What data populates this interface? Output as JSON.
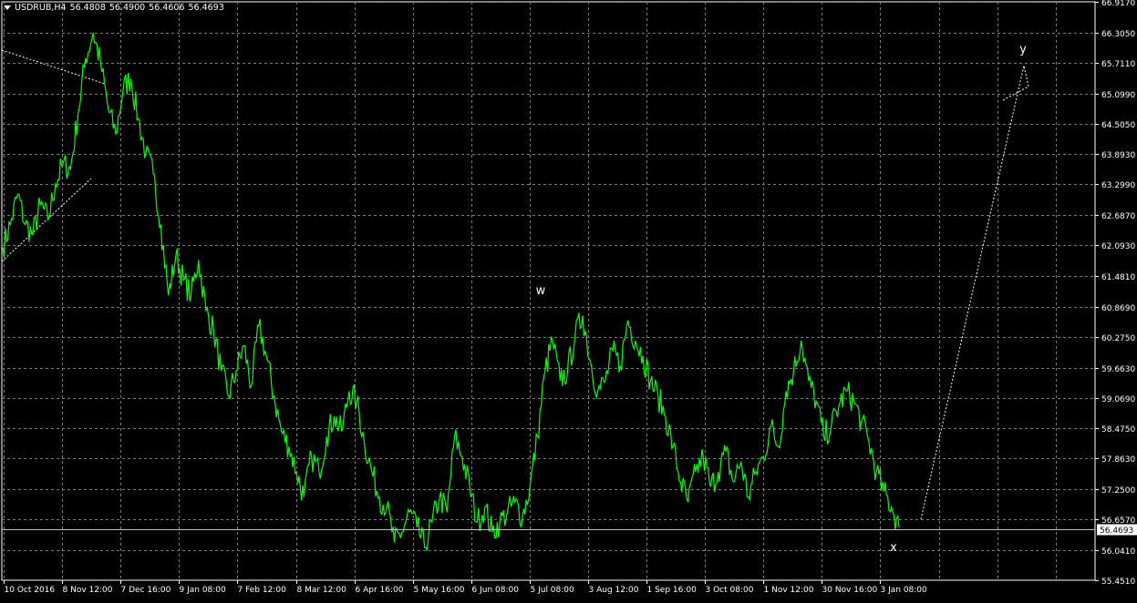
{
  "window": {
    "symbol_timeframe": "USDRUB,H4",
    "ohlc": [
      "56.4808",
      "56.4900",
      "56.4606",
      "56.4693"
    ]
  },
  "colors": {
    "background": "#000000",
    "grid": "#7a7a7a",
    "price_line": "#00ff00",
    "axis_text": "#ffffff",
    "annotation": "#ffffff"
  },
  "chart_data": {
    "type": "line",
    "symbol": "USDRUB",
    "timeframe": "H4",
    "grid": true,
    "y_ticks": [
      "66.9170",
      "66.3050",
      "65.7110",
      "65.0990",
      "64.5050",
      "63.8930",
      "63.2990",
      "62.6870",
      "62.0930",
      "61.4810",
      "60.8690",
      "60.2750",
      "59.6630",
      "59.0690",
      "58.4750",
      "57.8630",
      "57.2500",
      "56.6570",
      "56.0410",
      "55.4510"
    ],
    "ylim": [
      55.451,
      66.917
    ],
    "x_ticks": [
      "10 Oct 2016",
      "8 Nov 12:00",
      "7 Dec 16:00",
      "9 Jan 08:00",
      "7 Feb 12:00",
      "8 Mar 12:00",
      "6 Apr 16:00",
      "5 May 16:00",
      "6 Jun 08:00",
      "5 Jul 08:00",
      "3 Aug 12:00",
      "1 Sep 16:00",
      "3 Oct 08:00",
      "1 Nov 12:00",
      "30 Nov 16:00",
      "3 Jan 08:00"
    ],
    "current_price": "56.4693",
    "series": [
      {
        "values": [
          [
            0,
            62.05
          ],
          [
            1,
            62.5
          ],
          [
            2,
            63.1
          ],
          [
            3,
            62.5
          ],
          [
            4,
            62.3
          ],
          [
            5,
            62.9
          ],
          [
            6,
            62.6
          ],
          [
            7,
            63.3
          ],
          [
            8,
            63.7
          ],
          [
            9,
            63.6
          ],
          [
            10,
            64.7
          ],
          [
            11,
            65.8
          ],
          [
            12,
            66.3
          ],
          [
            13,
            65.7
          ],
          [
            14,
            64.8
          ],
          [
            15,
            64.3
          ],
          [
            16,
            65.2
          ],
          [
            17,
            65.4
          ],
          [
            18,
            64.6
          ],
          [
            19,
            63.9
          ],
          [
            20,
            63.5
          ],
          [
            21,
            62.5
          ],
          [
            22,
            61.1
          ],
          [
            23,
            61.9
          ],
          [
            24,
            61.4
          ],
          [
            25,
            61.1
          ],
          [
            26,
            61.8
          ],
          [
            27,
            60.8
          ],
          [
            28,
            60.4
          ],
          [
            29,
            59.6
          ],
          [
            30,
            59.1
          ],
          [
            31,
            59.6
          ],
          [
            32,
            60.1
          ],
          [
            33,
            59.3
          ],
          [
            34,
            60.5
          ],
          [
            35,
            59.9
          ],
          [
            36,
            59.1
          ],
          [
            37,
            58.4
          ],
          [
            38,
            58.1
          ],
          [
            39,
            57.6
          ],
          [
            40,
            57.1
          ],
          [
            41,
            57.9
          ],
          [
            42,
            57.6
          ],
          [
            43,
            58.3
          ],
          [
            44,
            58.7
          ],
          [
            45,
            58.4
          ],
          [
            46,
            59.2
          ],
          [
            47,
            59.0
          ],
          [
            48,
            58.2
          ],
          [
            49,
            57.6
          ],
          [
            50,
            57.1
          ],
          [
            51,
            56.9
          ],
          [
            52,
            56.2
          ],
          [
            53,
            56.4
          ],
          [
            54,
            56.8
          ],
          [
            55,
            56.5
          ],
          [
            56,
            56.1
          ],
          [
            57,
            56.6
          ],
          [
            58,
            57.1
          ],
          [
            59,
            56.8
          ],
          [
            60,
            58.3
          ],
          [
            61,
            57.9
          ],
          [
            62,
            57.3
          ],
          [
            63,
            56.6
          ],
          [
            64,
            56.9
          ],
          [
            65,
            56.4
          ],
          [
            66,
            56.6
          ],
          [
            67,
            56.8
          ],
          [
            68,
            57.0
          ],
          [
            69,
            56.7
          ],
          [
            70,
            57.3
          ],
          [
            71,
            58.3
          ],
          [
            72,
            59.6
          ],
          [
            73,
            60.2
          ],
          [
            74,
            59.4
          ],
          [
            75,
            59.6
          ],
          [
            76,
            60.3
          ],
          [
            77,
            60.7
          ],
          [
            78,
            59.8
          ],
          [
            79,
            59.2
          ],
          [
            80,
            59.4
          ],
          [
            81,
            60.0
          ],
          [
            82,
            59.7
          ],
          [
            83,
            60.6
          ],
          [
            84,
            60.2
          ],
          [
            85,
            59.9
          ],
          [
            86,
            59.4
          ],
          [
            87,
            59.1
          ],
          [
            88,
            58.7
          ],
          [
            89,
            58.1
          ],
          [
            90,
            57.4
          ],
          [
            91,
            57.0
          ],
          [
            92,
            57.6
          ],
          [
            93,
            57.9
          ],
          [
            94,
            57.3
          ],
          [
            95,
            57.6
          ],
          [
            96,
            58.0
          ],
          [
            97,
            57.4
          ],
          [
            98,
            57.8
          ],
          [
            99,
            57.1
          ],
          [
            100,
            57.6
          ],
          [
            101,
            57.9
          ],
          [
            102,
            58.5
          ],
          [
            103,
            58.1
          ],
          [
            104,
            59.2
          ],
          [
            105,
            59.6
          ],
          [
            106,
            60.2
          ],
          [
            107,
            59.4
          ],
          [
            108,
            59.0
          ],
          [
            109,
            58.3
          ],
          [
            110,
            58.5
          ],
          [
            111,
            58.9
          ],
          [
            112,
            59.2
          ],
          [
            113,
            59.0
          ],
          [
            114,
            58.6
          ],
          [
            115,
            58.2
          ],
          [
            116,
            57.6
          ],
          [
            117,
            57.2
          ],
          [
            118,
            56.9
          ],
          [
            119,
            56.5
          ]
        ]
      }
    ],
    "annotations": [
      {
        "label": "w"
      },
      {
        "label": "x"
      },
      {
        "label": "y"
      }
    ]
  }
}
